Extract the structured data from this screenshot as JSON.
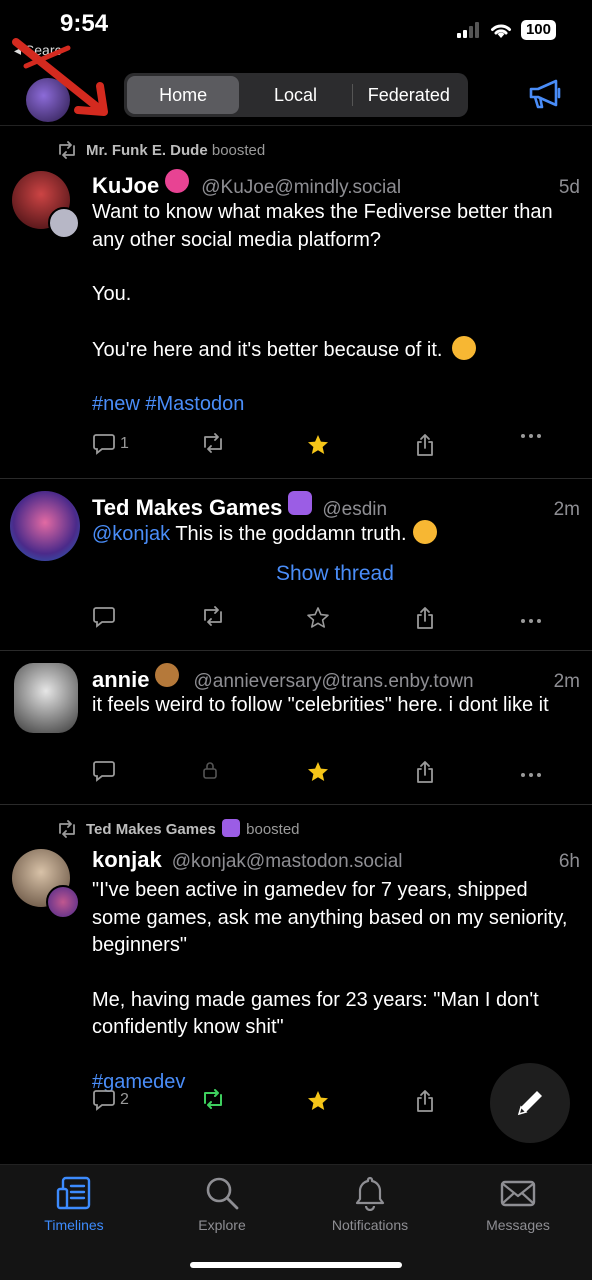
{
  "status_bar": {
    "time": "9:54",
    "back_label": "Searc",
    "battery": "100"
  },
  "header": {
    "segments": [
      "Home",
      "Local",
      "Federated"
    ],
    "active_segment": "Home",
    "announcements_icon": "megaphone-icon"
  },
  "posts": [
    {
      "boosted_by": "Mr. Funk E. Dude",
      "boosted_suffix": "boosted",
      "name": "KuJoe",
      "handle": "@KuJoe@mindly.social",
      "time": "5d",
      "body": [
        "Want to know what makes the Fediverse better than any other social media platform?",
        "You.",
        "You're here and it's better because of it."
      ],
      "tags": "#new #Mastodon",
      "replies": "1",
      "favourited": true,
      "boosted": false
    },
    {
      "name": "Ted Makes Games",
      "handle": "@esdin",
      "time": "2m",
      "mention": "@konjak",
      "body": "This is the goddamn truth.",
      "show_thread": "Show thread",
      "favourited": false
    },
    {
      "name": "annie",
      "handle": "@annieversary@trans.enby.town",
      "time": "2m",
      "body": "it feels weird to follow \"celebrities\" here. i dont like it",
      "favourited": true,
      "boost_locked": true
    },
    {
      "boosted_by": "Ted Makes Games",
      "boosted_suffix": "boosted",
      "name": "konjak",
      "handle": "@konjak@mastodon.social",
      "time": "6h",
      "body": [
        "\"I've been active in gamedev for 7 years, shipped some games, ask me anything based on my seniority, beginners\"",
        "Me, having made games for 23 years: \"Man I don't confidently know shit\""
      ],
      "tags": "#gamedev",
      "replies": "2",
      "favourited": true,
      "boosted": true
    }
  ],
  "tab_bar": {
    "items": [
      "Timelines",
      "Explore",
      "Notifications",
      "Messages"
    ],
    "active": "Timelines"
  },
  "colors": {
    "accent": "#4a8df8",
    "star": "#f5c518",
    "boost_active": "#3ecf5e"
  }
}
